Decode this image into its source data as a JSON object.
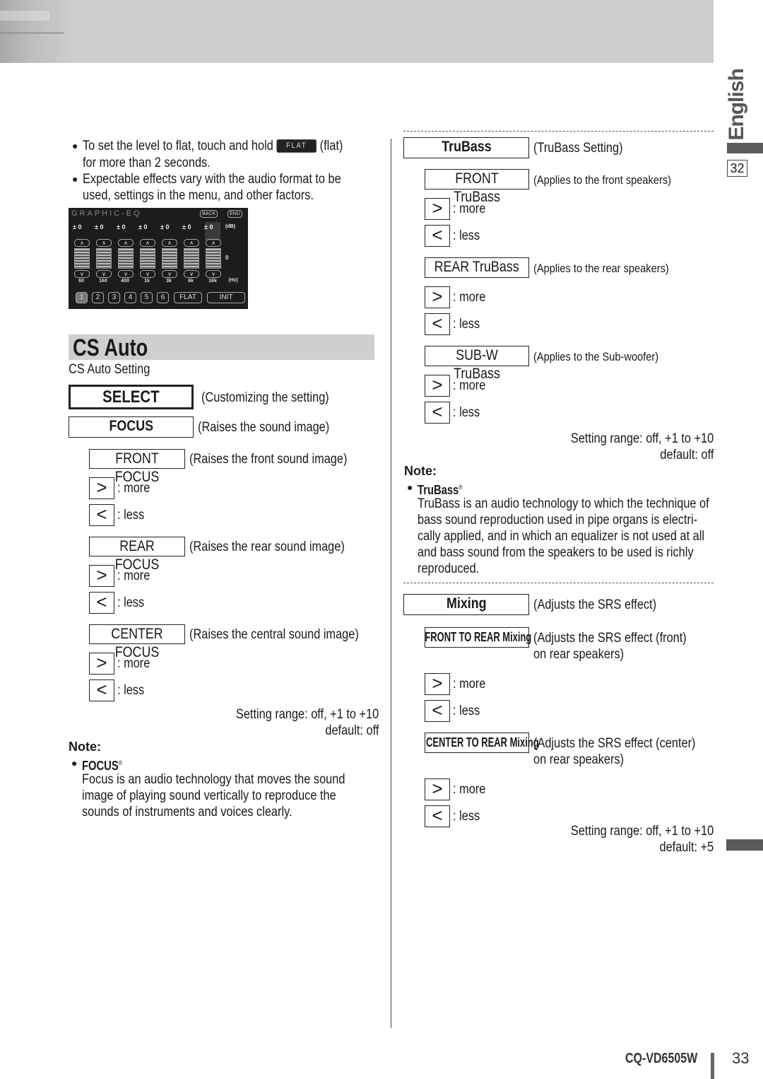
{
  "sidebar": {
    "language": "English",
    "section_page": "32"
  },
  "intro": {
    "bullet1_pre": "To set the level to flat, touch and hold",
    "flat_chip": "FLAT",
    "bullet1_post": "(flat)",
    "bullet1_line2": "for more than 2 seconds.",
    "bullet2_line1": "Expectable effects vary with the audio format to be",
    "bullet2_line2": "used, settings in the menu, and other factors."
  },
  "graphic_eq": {
    "title": "GRAPHIC-EQ",
    "back": "BACK",
    "end": "END",
    "db_unit": "(dB)",
    "hz_unit": "(Hz)",
    "zero_label": "0",
    "bands": [
      {
        "freq": "60",
        "level": "± 0"
      },
      {
        "freq": "160",
        "level": "± 0"
      },
      {
        "freq": "400",
        "level": "± 0"
      },
      {
        "freq": "1k",
        "level": "± 0"
      },
      {
        "freq": "3k",
        "level": "± 0"
      },
      {
        "freq": "6k",
        "level": "± 0"
      },
      {
        "freq": "16k",
        "level": "± 0"
      }
    ],
    "up_glyph": "∧",
    "down_glyph": "∨",
    "presets": [
      "1",
      "2",
      "3",
      "4",
      "5",
      "6"
    ],
    "flat": "FLAT",
    "init": "INIT"
  },
  "cs_auto": {
    "title": "CS Auto",
    "subtitle": "CS Auto Setting",
    "select": {
      "label": "SELECT",
      "desc": "(Customizing the setting)"
    },
    "focus": {
      "label": "FOCUS",
      "desc": "(Raises the sound image)"
    },
    "items": [
      {
        "label": "FRONT FOCUS",
        "desc": "(Raises the front sound image)"
      },
      {
        "label": "REAR FOCUS",
        "desc": "(Raises the rear sound image)"
      },
      {
        "label": "CENTER FOCUS",
        "desc": "(Raises the central sound image)"
      }
    ],
    "more_glyph": ">",
    "less_glyph": "<",
    "more": ": more",
    "less": ": less",
    "range": "Setting range: off, +1 to +10",
    "default": "default: off",
    "note_heading": "Note:",
    "note_title": "FOCUS",
    "note_reg": "®",
    "note_lines": [
      "Focus is an audio technology that moves the sound",
      "image of playing sound vertically to reproduce the",
      "sounds of instruments and voices clearly."
    ]
  },
  "trubass": {
    "label": "TruBass",
    "desc": "(TruBass Setting)",
    "items": [
      {
        "label": "FRONT TruBass",
        "desc": "(Applies to the front speakers)"
      },
      {
        "label": "REAR TruBass",
        "desc": "(Applies to the rear speakers)"
      },
      {
        "label": "SUB-W TruBass",
        "desc": "(Applies to the Sub-woofer)"
      }
    ],
    "range": "Setting range: off, +1 to +10",
    "default": "default: off",
    "note_heading": "Note:",
    "note_title": "TruBass",
    "note_reg": "®",
    "note_lines": [
      "TruBass is an audio technology to which the technique of",
      "bass sound reproduction used in pipe organs is electri-",
      "cally applied, and in which an equalizer is not used at all",
      "and bass sound from the speakers to be used is richly",
      "reproduced."
    ]
  },
  "mixing": {
    "label": "Mixing",
    "desc": "(Adjusts the SRS effect)",
    "items": [
      {
        "label": "FRONT TO REAR Mixing",
        "desc1": "(Adjusts the SRS effect (front)",
        "desc2": "on rear speakers)"
      },
      {
        "label": "CENTER TO REAR Mixing",
        "desc1": "(Adjusts the SRS effect (center)",
        "desc2": "on rear speakers)"
      }
    ],
    "range": "Setting range: off, +1 to +10",
    "default": "default: +5"
  },
  "footer": {
    "model": "CQ-VD6505W",
    "page": "33"
  }
}
